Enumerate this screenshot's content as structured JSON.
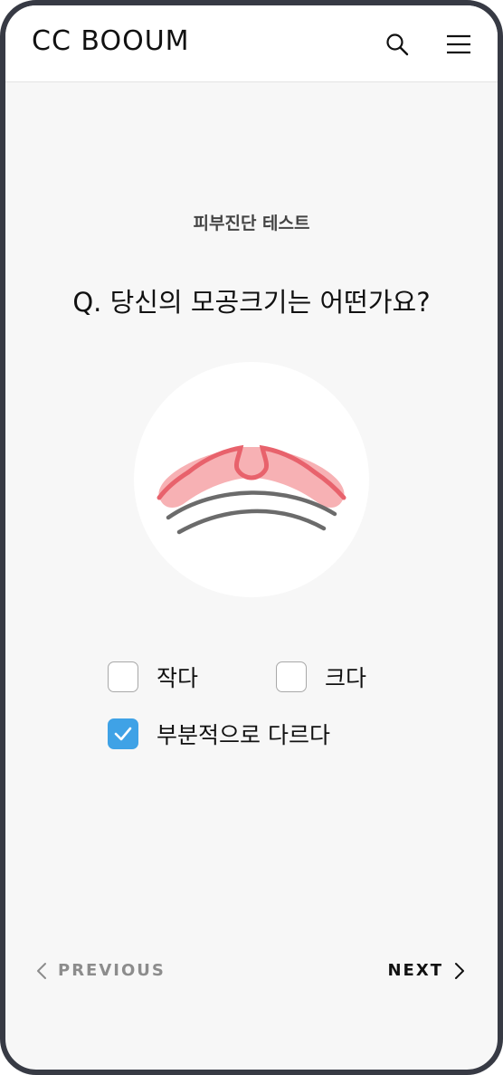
{
  "header": {
    "logo": "CC BOOUM",
    "search_icon": "search-icon",
    "menu_icon": "hamburger-menu-icon"
  },
  "test": {
    "subtitle": "피부진단 테스트",
    "question": "Q. 당신의 모공크기는 어떤가요?",
    "illustration": "pore-illustration"
  },
  "options": [
    {
      "label": "작다",
      "checked": false
    },
    {
      "label": "크다",
      "checked": false
    },
    {
      "label": "부분적으로 다르다",
      "checked": true
    }
  ],
  "nav": {
    "previous_label": "PREVIOUS",
    "next_label": "NEXT"
  },
  "colors": {
    "accent": "#3fa2e6",
    "skin": "#f7b1b4",
    "pore_outline": "#e8626c",
    "frame": "#373a44"
  }
}
